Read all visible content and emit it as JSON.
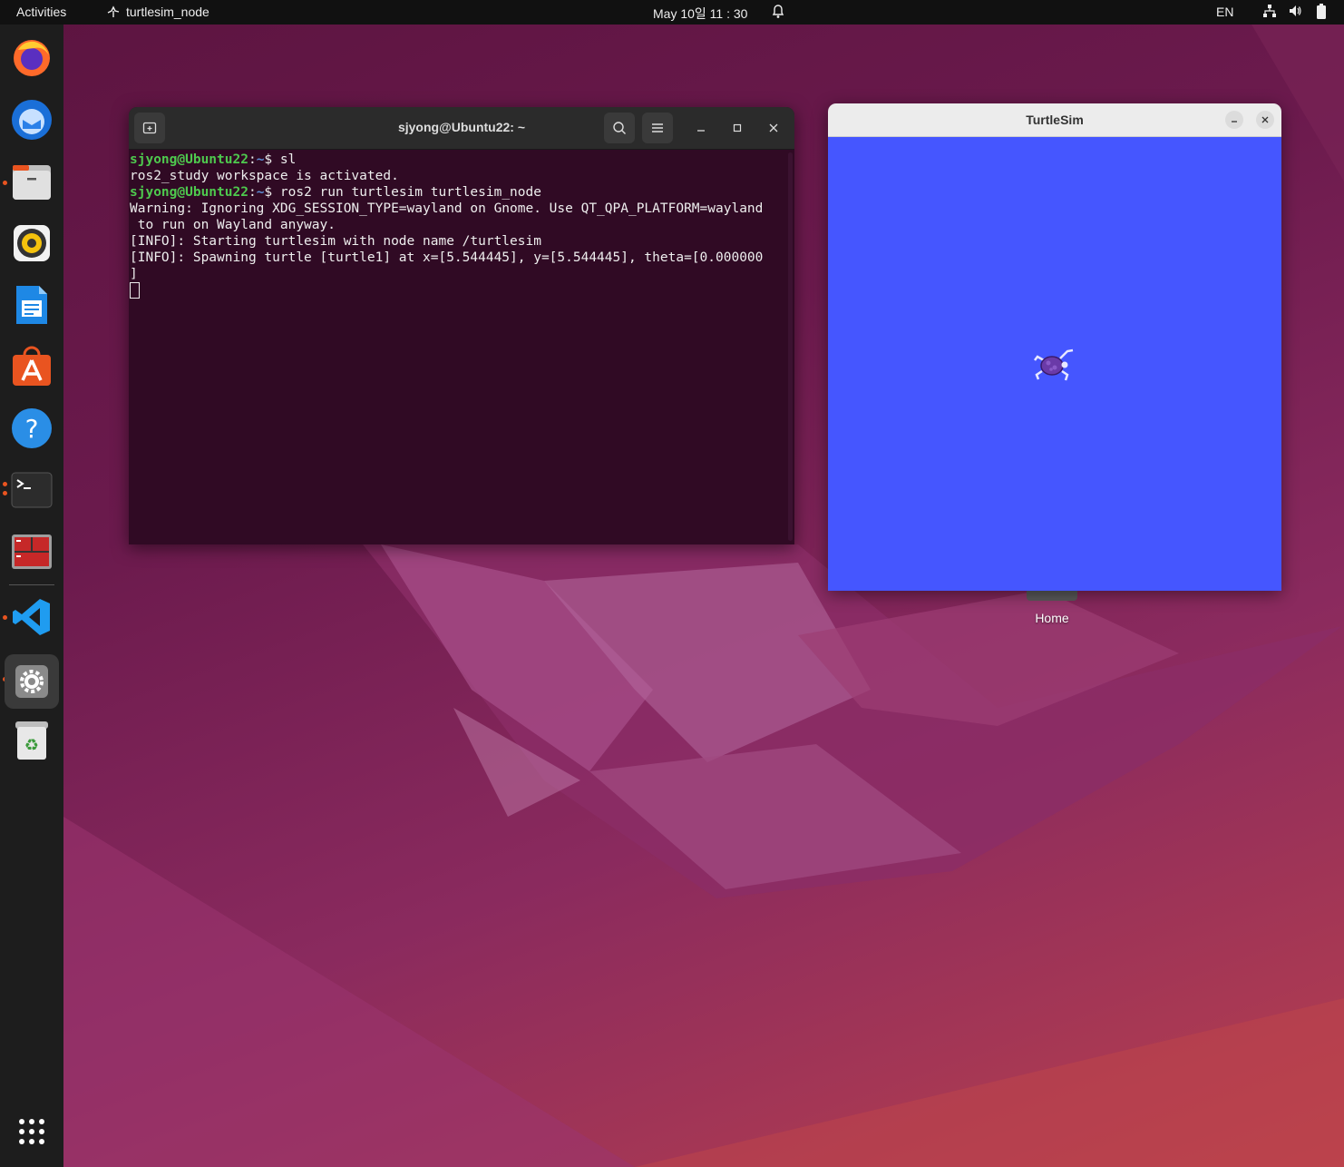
{
  "topbar": {
    "activities": "Activities",
    "app_name": "turtlesim_node",
    "clock": "May 10일  11 : 30",
    "language": "EN"
  },
  "dock": {
    "items": [
      {
        "name": "Firefox",
        "icon": "firefox-icon"
      },
      {
        "name": "Thunderbird",
        "icon": "thunderbird-icon"
      },
      {
        "name": "Files",
        "icon": "files-icon"
      },
      {
        "name": "Rhythmbox",
        "icon": "rhythmbox-icon"
      },
      {
        "name": "LibreOffice Writer",
        "icon": "writer-icon"
      },
      {
        "name": "Ubuntu Software",
        "icon": "software-icon"
      },
      {
        "name": "Help",
        "icon": "help-icon"
      },
      {
        "name": "Terminal",
        "icon": "terminal-icon"
      },
      {
        "name": "Terminator",
        "icon": "terminator-icon"
      },
      {
        "name": "Visual Studio Code",
        "icon": "vscode-icon"
      },
      {
        "name": "Settings",
        "icon": "settings-icon"
      },
      {
        "name": "Trash",
        "icon": "trash-icon"
      }
    ]
  },
  "terminal": {
    "title": "sjyong@Ubuntu22: ~",
    "lines": [
      {
        "user": "sjyong@Ubuntu22",
        "path": "~",
        "command": "sl"
      },
      {
        "text": "ros2_study workspace is activated."
      },
      {
        "user": "sjyong@Ubuntu22",
        "path": "~",
        "command": "ros2 run turtlesim turtlesim_node"
      },
      {
        "text": "Warning: Ignoring XDG_SESSION_TYPE=wayland on Gnome. Use QT_QPA_PLATFORM=wayland"
      },
      {
        "text": " to run on Wayland anyway."
      },
      {
        "text": "[INFO]: Starting turtlesim with node name /turtlesim"
      },
      {
        "text": "[INFO]: Spawning turtle [turtle1] at x=[5.544445], y=[5.544445], theta=[0.000000"
      },
      {
        "text": "]"
      }
    ]
  },
  "turtlesim": {
    "title": "TurtleSim",
    "background_color": "#4556ff"
  },
  "desktop": {
    "home_label": "Home"
  },
  "colors": {
    "terminal_bg": "#300a24",
    "prompt_user": "#4ec94e",
    "prompt_path": "#5d8fd6",
    "accent": "#e95420"
  }
}
